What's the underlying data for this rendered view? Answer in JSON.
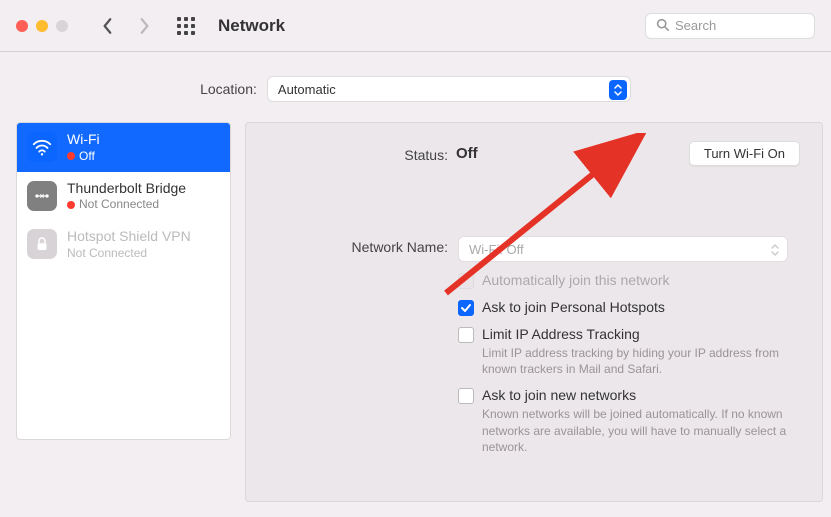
{
  "titlebar": {
    "title": "Network",
    "search_placeholder": "Search"
  },
  "location": {
    "label": "Location:",
    "selected": "Automatic"
  },
  "sidebar": {
    "items": [
      {
        "title": "Wi-Fi",
        "status": "Off",
        "dot": "red",
        "active": true
      },
      {
        "title": "Thunderbolt Bridge",
        "status": "Not Connected",
        "dot": "red",
        "active": false
      },
      {
        "title": "Hotspot Shield VPN",
        "status": "Not Connected",
        "dot": "gray",
        "active": false,
        "disabled": true
      }
    ]
  },
  "detail": {
    "status_label": "Status:",
    "status_value": "Off",
    "toggle_button": "Turn Wi-Fi On",
    "network_name_label": "Network Name:",
    "network_name_value": "Wi-Fi: Off",
    "checks": [
      {
        "label": "Automatically join this network",
        "checked": false,
        "disabled": true
      },
      {
        "label": "Ask to join Personal Hotspots",
        "checked": true,
        "disabled": false
      },
      {
        "label": "Limit IP Address Tracking",
        "checked": false,
        "disabled": false,
        "desc": "Limit IP address tracking by hiding your IP address from known trackers in Mail and Safari."
      },
      {
        "label": "Ask to join new networks",
        "checked": false,
        "disabled": false,
        "desc": "Known networks will be joined automatically. If no known networks are available, you will have to manually select a network."
      }
    ]
  }
}
